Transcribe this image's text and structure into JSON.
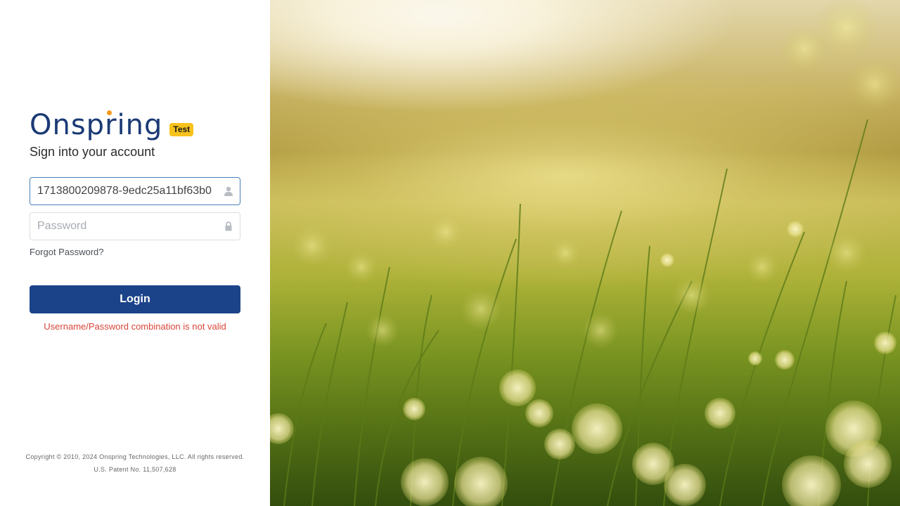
{
  "brand": {
    "logo_text": "Onspring",
    "env_badge": "Test"
  },
  "login_form": {
    "heading": "Sign into your account",
    "username": {
      "value": "1713800209878-9edc25a11bf63b0",
      "placeholder": "",
      "icon": "user-icon"
    },
    "password": {
      "value": "",
      "placeholder": "Password",
      "icon": "lock-icon"
    },
    "forgot_password_label": "Forgot Password?",
    "login_label": "Login",
    "error_message": "Username/Password combination is not valid"
  },
  "footer": {
    "copyright": "Copyright © 2010, 2024 Onspring Technologies, LLC. All rights reserved.",
    "patent": "U.S. Patent No. 11,507,628"
  },
  "colors": {
    "brand_navy": "#1b3a75",
    "logo_dot": "#f39a1e",
    "badge": "#f7c21a",
    "login_button": "#1b4389",
    "error": "#d9453a"
  }
}
